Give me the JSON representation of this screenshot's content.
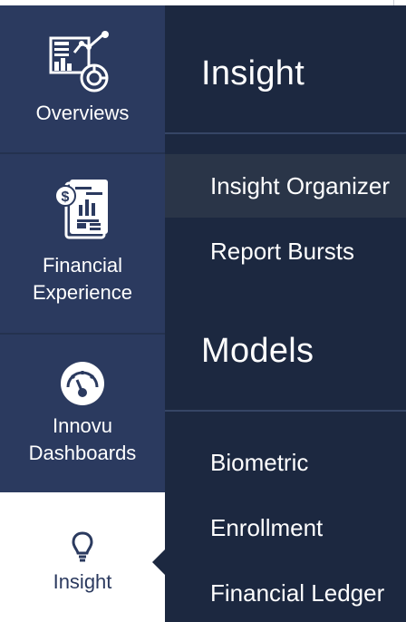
{
  "rail": {
    "items": [
      {
        "label": "Overviews",
        "icon": "chart-dashboard-icon"
      },
      {
        "label_line1": "Financial",
        "label_line2": "Experience",
        "icon": "financial-report-icon"
      },
      {
        "label_line1": "Innovu",
        "label_line2": "Dashboards",
        "icon": "gauge-icon"
      },
      {
        "label": "Insight",
        "icon": "lightbulb-icon",
        "active": true
      }
    ]
  },
  "panel": {
    "sections": [
      {
        "title": "Insight",
        "items": [
          "Insight Organizer",
          "Report Bursts"
        ],
        "selected": "Insight Organizer"
      },
      {
        "title": "Models",
        "items": [
          "Biometric",
          "Enrollment",
          "Financial Ledger"
        ]
      }
    ]
  },
  "colors": {
    "rail_bg": "#2b3a5f",
    "panel_bg": "#1c2840",
    "selected_row": "#2a3548",
    "active_rail_bg": "#ffffff"
  }
}
